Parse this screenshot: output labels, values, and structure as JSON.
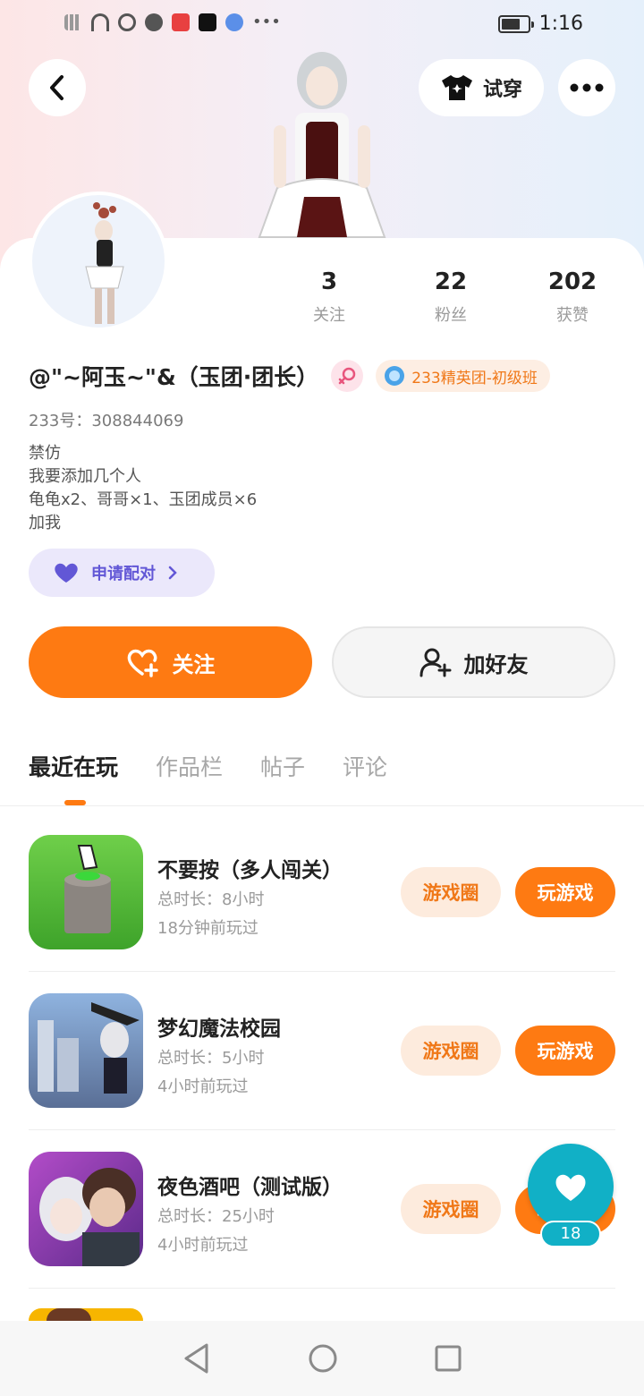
{
  "status_bar": {
    "time": "1:16"
  },
  "header": {
    "try_on_label": "试穿"
  },
  "profile": {
    "stats": [
      {
        "value": "3",
        "label": "关注"
      },
      {
        "value": "22",
        "label": "粉丝"
      },
      {
        "value": "202",
        "label": "获赞"
      }
    ],
    "name": "@\"~阿玉~\"&（玉团·团长）",
    "badge": "233精英团-初级班",
    "uid": "233号：308844069",
    "bio": [
      "禁仿",
      "我要添加几个人",
      "龟龟x2、哥哥×1、玉团成员×6",
      "加我"
    ],
    "pair_label": "申请配对"
  },
  "actions": {
    "follow_label": "关注",
    "add_friend_label": "加好友"
  },
  "tabs": [
    "最近在玩",
    "作品栏",
    "帖子",
    "评论"
  ],
  "games": [
    {
      "title": "不要按（多人闯关）",
      "duration": "总时长：8小时",
      "last": "18分钟前玩过",
      "circle": "游戏圈",
      "play": "玩游戏"
    },
    {
      "title": "梦幻魔法校园",
      "duration": "总时长：5小时",
      "last": "4小时前玩过",
      "circle": "游戏圈",
      "play": "玩游戏"
    },
    {
      "title": "夜色酒吧（测试版）",
      "duration": "总时长：25小时",
      "last": "4小时前玩过",
      "circle": "游戏圈",
      "play": "玩游戏"
    }
  ],
  "like_fab": {
    "count": "18"
  },
  "colors": {
    "accent": "#fe7a12",
    "pair": "#6257d6",
    "fab": "#11b0c6"
  }
}
